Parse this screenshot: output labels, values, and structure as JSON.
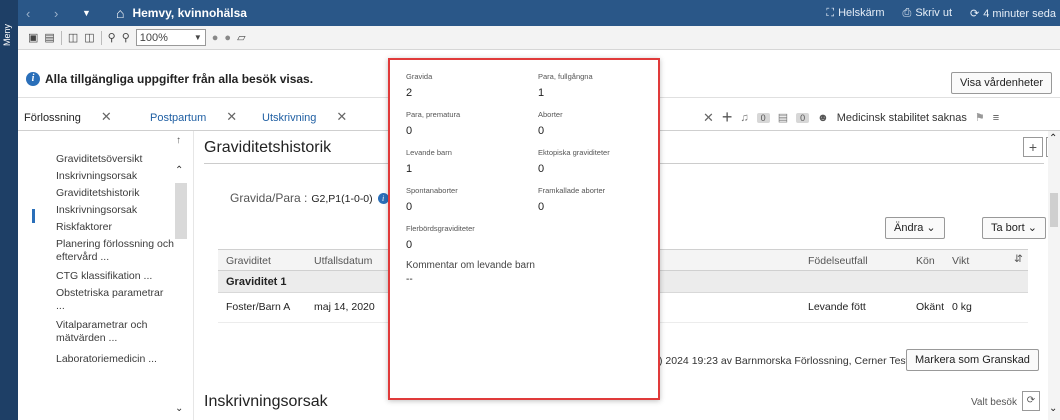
{
  "app": {
    "menu_label": "Meny",
    "title": "Hemvy, kvinnohälsa",
    "header_right": [
      {
        "icon": "expand-icon",
        "label": "Helskärm"
      },
      {
        "icon": "printer-icon",
        "label": "Skriv ut"
      },
      {
        "icon": "refresh-icon",
        "label": "4 minuter seda"
      }
    ]
  },
  "toolbar": {
    "zoom_value": "100%"
  },
  "info": {
    "message": "Alla tillgängliga uppgifter från alla besök visas.",
    "button": "Visa vårdenheter"
  },
  "tabs": [
    {
      "label": "Förlossning"
    },
    {
      "label": "Postpartum"
    },
    {
      "label": "Utskrivning"
    }
  ],
  "tabs_right": {
    "badge1": "0",
    "badge2": "0",
    "stability": "Medicinsk stabilitet saknas"
  },
  "sidebar": {
    "items": [
      "Graviditetsöversikt",
      "Inskrivningsorsak",
      "Graviditetshistorik",
      "Inskrivningsorsak",
      "Riskfaktorer",
      "Planering förlossning och eftervård ...",
      "CTG klassifikation ...",
      "Obstetriska parametrar ...",
      "Vitalparametrar och mätvärden ...",
      "Laboratoriemedicin ..."
    ],
    "active_index": 2
  },
  "main": {
    "section_title": "Graviditetshistorik",
    "gp_label": "Gravida/Para :",
    "gp_value": "G2,P1(1-0-0)",
    "andra_button": "Ändra",
    "tabort_button": "Ta bort",
    "columns": [
      "Graviditet",
      "Utfallsdatum",
      "Födelseutfall",
      "Kön",
      "Vikt"
    ],
    "group": "Graviditet 1",
    "row": {
      "graviditet": "Foster/Barn A",
      "utfallsdatum": "maj 14, 2020",
      "fodelseutfall": "Levande fött",
      "kon": "Okänt",
      "vikt": "0 kg"
    },
    "footer_text": ") 2024 19:23 av Barnmorska Förlossning, Cerner Test",
    "markera_button": "Markera som Granskad",
    "section2_title": "Inskrivningsorsak",
    "valt_besok": "Valt besök"
  },
  "popup": {
    "fields": [
      {
        "label": "Gravida",
        "value": "2"
      },
      {
        "label": "Para, fullgångna",
        "value": "1"
      },
      {
        "label": "Para, prematura",
        "value": "0"
      },
      {
        "label": "Aborter",
        "value": "0"
      },
      {
        "label": "Levande barn",
        "value": "1"
      },
      {
        "label": "Ektopiska graviditeter",
        "value": "0"
      },
      {
        "label": "Spontanaborter",
        "value": "0"
      },
      {
        "label": "Framkallade aborter",
        "value": "0"
      },
      {
        "label": "Flerbördsgraviditeter",
        "value": "0"
      }
    ],
    "comment_label": "Kommentar om levande barn",
    "comment_value": "--"
  },
  "colors": {
    "titlebar": "#2a5788",
    "popup_border": "#e03a3a",
    "accent": "#2a6fb9"
  }
}
